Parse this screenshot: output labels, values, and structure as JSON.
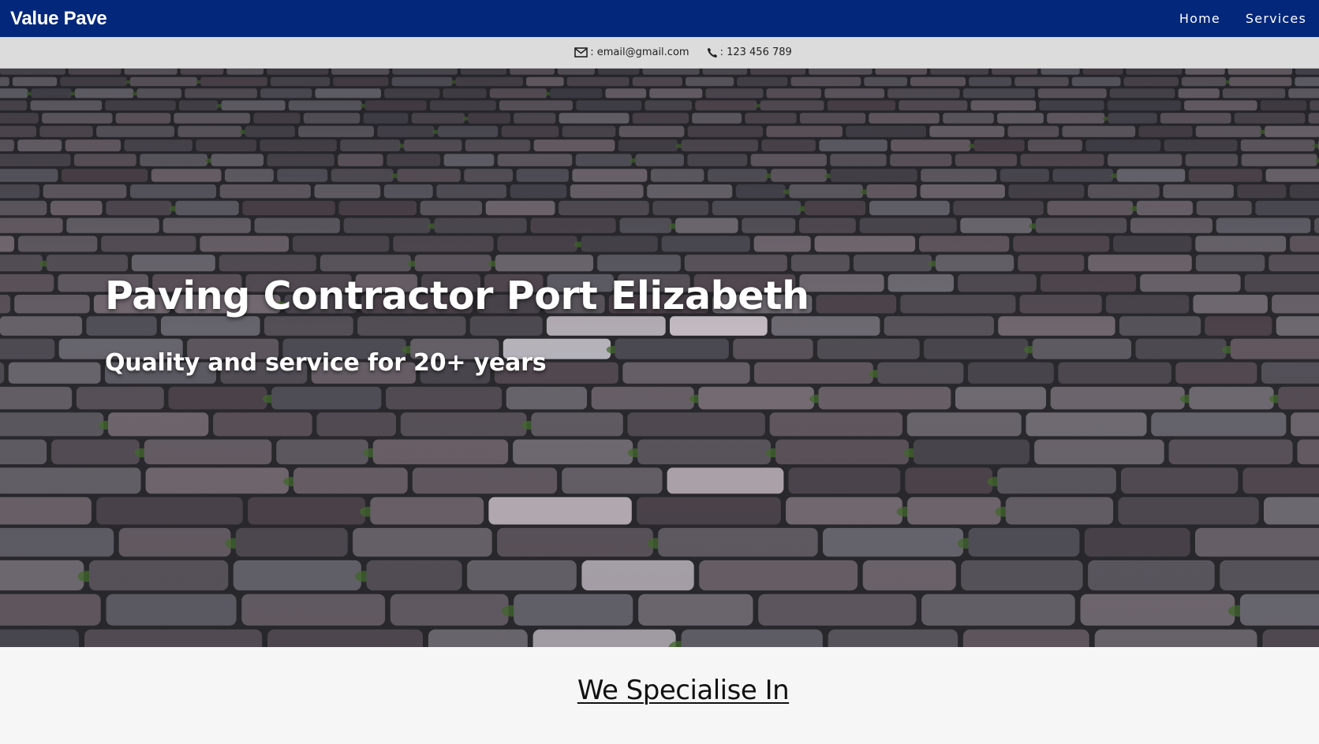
{
  "header": {
    "brand": "Value Pave",
    "nav": [
      {
        "label": "Home"
      },
      {
        "label": "Services"
      }
    ]
  },
  "contact_bar": {
    "email_label": ": email@gmail.com",
    "phone_label": ": 123 456 789",
    "email_icon": "envelope-icon",
    "phone_icon": "phone-icon"
  },
  "hero": {
    "title": "Paving Contractor Port Elizabeth",
    "subtitle": "Quality and service for 20+ years",
    "image": "cobblestone-paving-photo"
  },
  "main": {
    "section_heading": "We Specialise In"
  },
  "colors": {
    "navbar": "#03277b",
    "contact_bar": "#dcdcdc",
    "page_background": "#f6f6f6"
  }
}
